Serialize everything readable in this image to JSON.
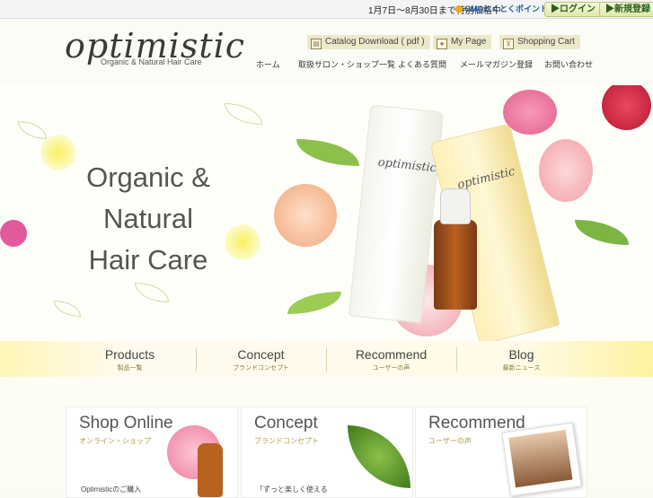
{
  "topbar": {
    "notice": "1月7日～8月30日まで特別価格中",
    "gmo_label": "GMOとくとくポイント",
    "login_label": "▶ログイン",
    "register_label": "▶新規登録"
  },
  "header": {
    "logo_text": "optimistic",
    "tagline": "Organic & Natural Hair Care",
    "util": {
      "catalog": "Catalog Download ( pdf )",
      "mypage": "My Page",
      "cart": "Shopping Cart"
    },
    "nav": [
      "ホーム",
      "取扱サロン・ショップ一覧",
      "よくある質問",
      "メールマガジン登録",
      "お問い合わせ"
    ]
  },
  "hero": {
    "line1": "Organic &",
    "line2": "Natural",
    "line3": "Hair Care",
    "bottle_logo": "optimistic"
  },
  "tabs": [
    {
      "en": "Products",
      "ja": "製品一覧"
    },
    {
      "en": "Concept",
      "ja": "ブランドコンセプト"
    },
    {
      "en": "Recommend",
      "ja": "ユーザーの声"
    },
    {
      "en": "Blog",
      "ja": "最新ニュース"
    }
  ],
  "cards": [
    {
      "title": "Shop Online",
      "sub": "オンライン・ショップ",
      "text": "Optimisticのご購入"
    },
    {
      "title": "Concept",
      "sub": "ブランドコンセプト",
      "text": "「ずっと楽しく使える"
    },
    {
      "title": "Recommend",
      "sub": "ユーザーの声",
      "text": ""
    }
  ],
  "colors": {
    "accent": "#b0a040",
    "green_button": "#2b5e1a",
    "rose": "#e8708a"
  }
}
